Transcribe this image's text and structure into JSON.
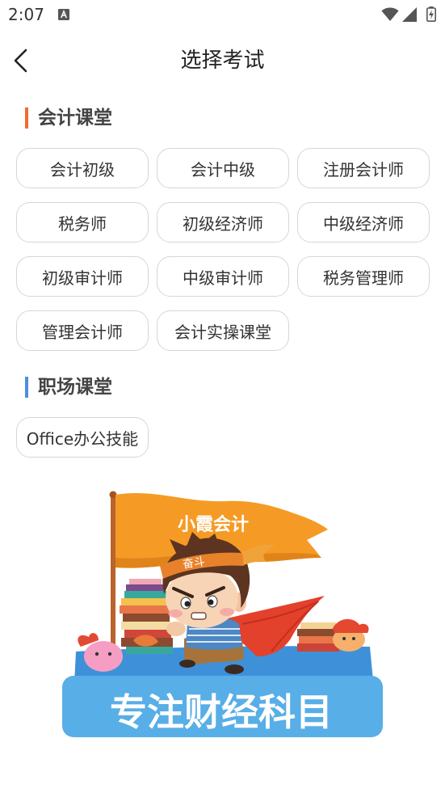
{
  "status_bar": {
    "time": "2:07",
    "notification_icon": "text-a-icon",
    "icons": [
      "wifi-icon",
      "signal-icon",
      "battery-charging-icon"
    ]
  },
  "header": {
    "back_icon": "chevron-left-icon",
    "title": "选择考试"
  },
  "sections": [
    {
      "title": "会计课堂",
      "accent_color": "#F26B2F",
      "items": [
        "会计初级",
        "会计中级",
        "注册会计师",
        "税务师",
        "初级经济师",
        "中级经济师",
        "初级审计师",
        "中级审计师",
        "税务管理师",
        "管理会计师",
        "会计实操课堂"
      ]
    },
    {
      "title": "职场课堂",
      "accent_color": "#4A8FE2",
      "items": [
        "Office办公技能"
      ]
    }
  ],
  "banner": {
    "flag_text": "小霞会计",
    "headband_text": "奋斗",
    "slogan": "专注财经科目"
  },
  "colors": {
    "text": "#333333",
    "chip_border": "#D6D6D6",
    "flag_orange": "#F59B25",
    "banner_blue": "#58AEE7",
    "cape_red": "#E3412B"
  }
}
